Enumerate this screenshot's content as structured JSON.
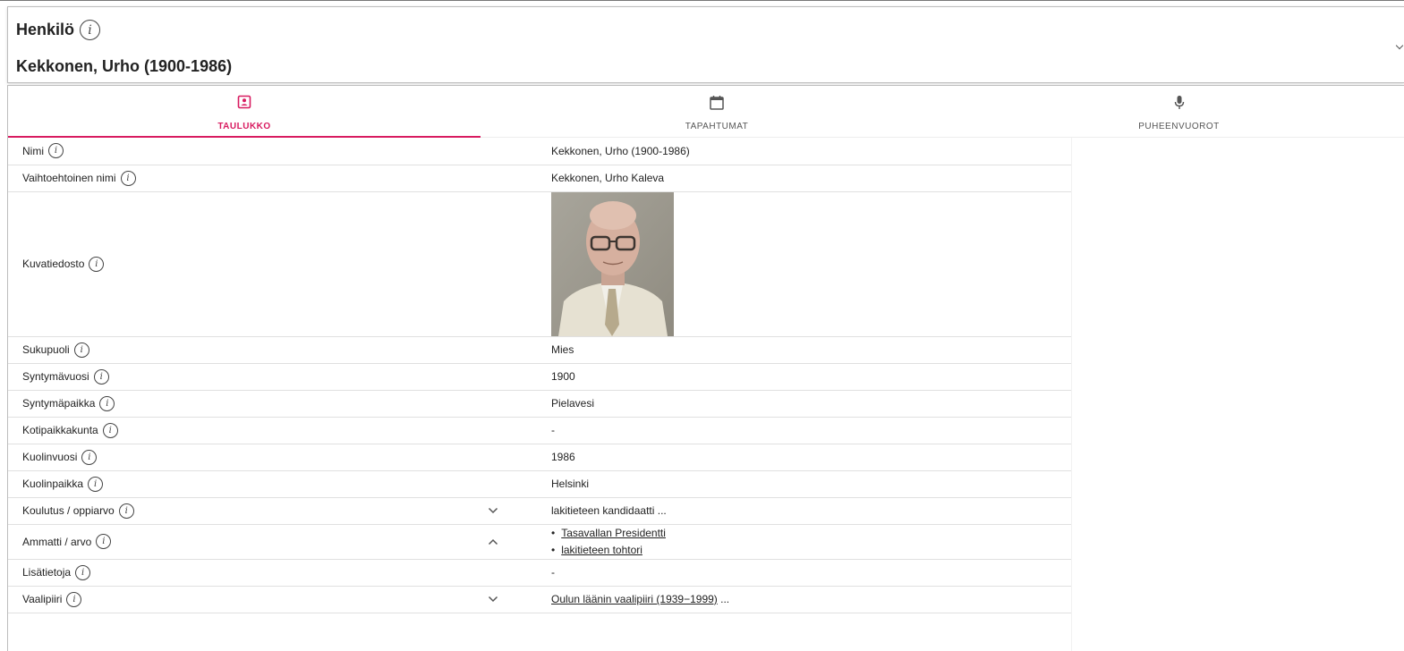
{
  "header": {
    "type_label": "Henkilö",
    "title": "Kekkonen, Urho (1900-1986)"
  },
  "tabs": [
    {
      "label": "TAULUKKO",
      "icon": "person-card-icon",
      "active": true
    },
    {
      "label": "TAPAHTUMAT",
      "icon": "calendar-icon",
      "active": false
    },
    {
      "label": "PUHEENVUOROT",
      "icon": "microphone-icon",
      "active": false
    }
  ],
  "rows": [
    {
      "label": "Nimi",
      "value": "Kekkonen, Urho (1900-1986)"
    },
    {
      "label": "Vaihtoehtoinen nimi",
      "value": "Kekkonen, Urho Kaleva"
    },
    {
      "label": "Kuvatiedosto",
      "value": ""
    },
    {
      "label": "Sukupuoli",
      "value": "Mies"
    },
    {
      "label": "Syntymävuosi",
      "value": "1900"
    },
    {
      "label": "Syntymäpaikka",
      "value": "Pielavesi"
    },
    {
      "label": "Kotipaikkakunta",
      "value": "-"
    },
    {
      "label": "Kuolinvuosi",
      "value": "1986"
    },
    {
      "label": "Kuolinpaikka",
      "value": "Helsinki"
    },
    {
      "label": "Koulutus / oppiarvo",
      "value": "lakitieteen kandidaatti ...",
      "expand": "chevron-down-icon"
    },
    {
      "label": "Ammatti / arvo",
      "values": [
        "Tasavallan Presidentti",
        "lakitieteen tohtori"
      ],
      "expand": "chevron-up-icon"
    },
    {
      "label": "Lisätietoja",
      "value": "-"
    },
    {
      "label": "Vaalipiiri",
      "link": "Oulun läänin vaalipiiri (1939−1999)",
      "suffix": " ...",
      "expand": "chevron-down-icon"
    }
  ],
  "colors": {
    "accent": "#d81b60",
    "text": "#222222",
    "border": "#e0e0e0"
  },
  "info_icon_glyph": "i"
}
